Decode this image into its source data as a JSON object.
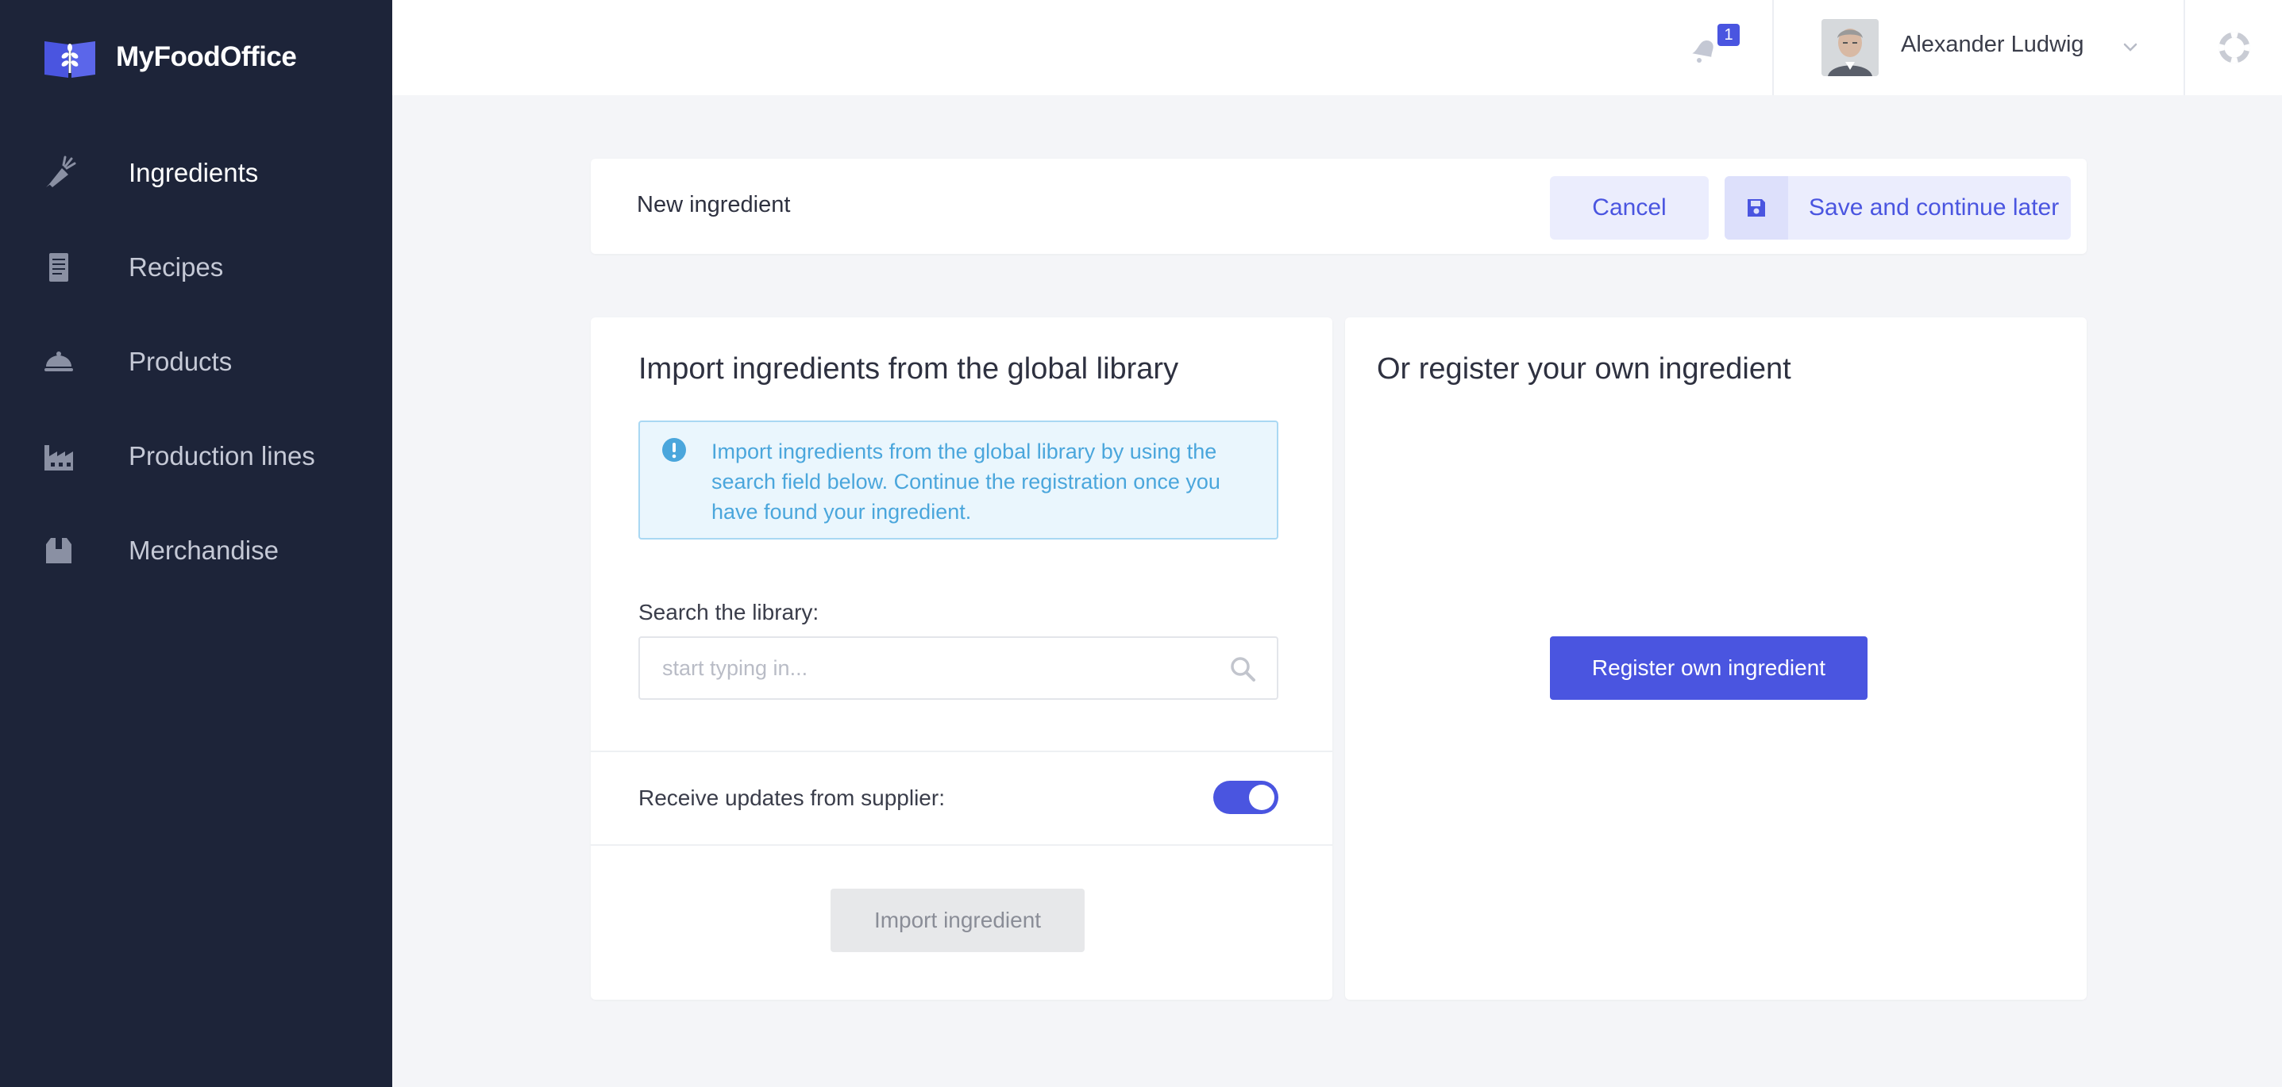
{
  "app": {
    "brand_name": "MyFoodOffice"
  },
  "sidebar": {
    "items": [
      {
        "label": "Ingredients",
        "icon": "carrot-icon",
        "active": true
      },
      {
        "label": "Recipes",
        "icon": "recipe-book-icon",
        "active": false
      },
      {
        "label": "Products",
        "icon": "cloche-icon",
        "active": false
      },
      {
        "label": "Production lines",
        "icon": "factory-icon",
        "active": false
      },
      {
        "label": "Merchandise",
        "icon": "box-icon",
        "active": false
      }
    ]
  },
  "header": {
    "notification_count": "1",
    "user_name": "Alexander Ludwig"
  },
  "titlebar": {
    "title": "New ingredient",
    "cancel_label": "Cancel",
    "save_label": "Save and continue later"
  },
  "import_panel": {
    "heading": "Import ingredients from the global library",
    "info_text": "Import ingredients from the global library by using the search field below. Continue the registration once you have found your ingredient.",
    "search_label": "Search the library:",
    "search_placeholder": "start typing in...",
    "search_value": "",
    "toggle_label": "Receive updates from supplier:",
    "toggle_on": true,
    "import_button_label": "Import ingredient"
  },
  "register_panel": {
    "heading": "Or register your own ingredient",
    "register_button_label": "Register own ingredient"
  },
  "colors": {
    "sidebar_bg": "#1d2439",
    "accent": "#4a55e0",
    "page_bg": "#f4f5f8",
    "info_bg": "#eaf6fd",
    "info_text": "#4aa6dc"
  }
}
